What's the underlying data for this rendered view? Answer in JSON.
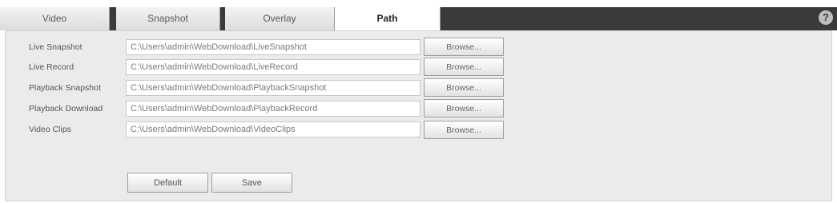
{
  "tabs": [
    {
      "label": "Video",
      "active": false
    },
    {
      "label": "Snapshot",
      "active": false
    },
    {
      "label": "Overlay",
      "active": false
    },
    {
      "label": "Path",
      "active": true
    }
  ],
  "help_icon": {
    "glyph": "?",
    "icon": "help-icon"
  },
  "path_rows": [
    {
      "label": "Live Snapshot",
      "value": "C:\\Users\\admin\\WebDownload\\LiveSnapshot",
      "browse_label": "Browse..."
    },
    {
      "label": "Live Record",
      "value": "C:\\Users\\admin\\WebDownload\\LiveRecord",
      "browse_label": "Browse..."
    },
    {
      "label": "Playback Snapshot",
      "value": "C:\\Users\\admin\\WebDownload\\PlaybackSnapshot",
      "browse_label": "Browse..."
    },
    {
      "label": "Playback Download",
      "value": "C:\\Users\\admin\\WebDownload\\PlaybackRecord",
      "browse_label": "Browse..."
    },
    {
      "label": "Video Clips",
      "value": "C:\\Users\\admin\\WebDownload\\VideoClips",
      "browse_label": "Browse..."
    }
  ],
  "actions": {
    "default_label": "Default",
    "save_label": "Save"
  },
  "colors": {
    "tab_bar": "#3a3a3a",
    "panel": "#ebebeb",
    "active_tab": "#ffffff"
  }
}
